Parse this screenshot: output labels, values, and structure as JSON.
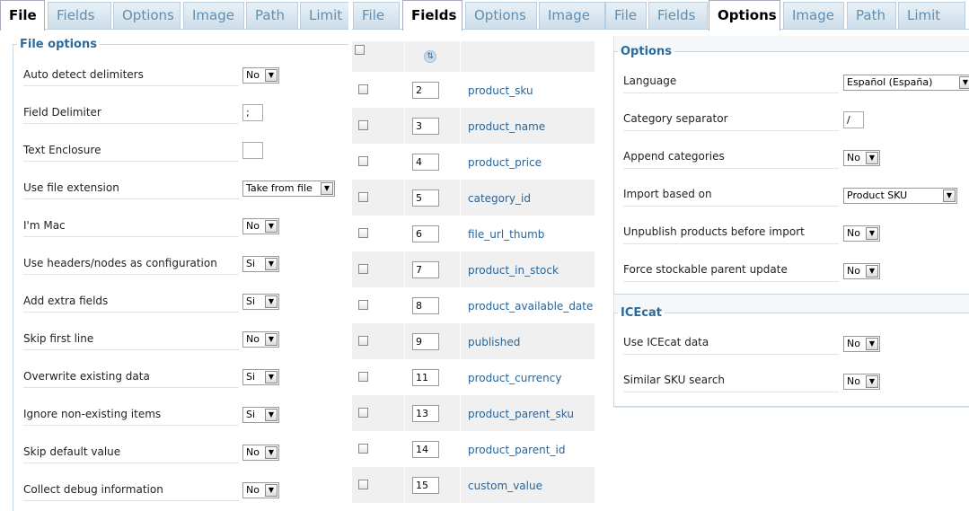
{
  "panel1": {
    "tabs": [
      "File",
      "Fields",
      "Options",
      "Image",
      "Path",
      "Limit"
    ],
    "legend": "File options",
    "rows": [
      {
        "label": "Auto detect delimiters",
        "type": "select",
        "value": "No"
      },
      {
        "label": "Field Delimiter",
        "type": "text",
        "value": ";"
      },
      {
        "label": "Text Enclosure",
        "type": "text",
        "value": ""
      },
      {
        "label": "Use file extension",
        "type": "select",
        "value": "Take from file"
      },
      {
        "label": "I'm Mac",
        "type": "select",
        "value": "No"
      },
      {
        "label": "Use headers/nodes as configuration",
        "type": "select",
        "value": "Si"
      },
      {
        "label": "Add extra fields",
        "type": "select",
        "value": "Si"
      },
      {
        "label": "Skip first line",
        "type": "select",
        "value": "No"
      },
      {
        "label": "Overwrite existing data",
        "type": "select",
        "value": "Si"
      },
      {
        "label": "Ignore non-existing items",
        "type": "select",
        "value": "Si"
      },
      {
        "label": "Skip default value",
        "type": "select",
        "value": "No"
      },
      {
        "label": "Collect debug information",
        "type": "select",
        "value": "No"
      }
    ]
  },
  "panel2": {
    "tabs": [
      "File",
      "Fields",
      "Options",
      "Image"
    ],
    "fields": [
      {
        "order": "2",
        "name": "product_sku"
      },
      {
        "order": "3",
        "name": "product_name"
      },
      {
        "order": "4",
        "name": "product_price"
      },
      {
        "order": "5",
        "name": "category_id"
      },
      {
        "order": "6",
        "name": "file_url_thumb"
      },
      {
        "order": "7",
        "name": "product_in_stock"
      },
      {
        "order": "8",
        "name": "product_available_date"
      },
      {
        "order": "9",
        "name": "published"
      },
      {
        "order": "11",
        "name": "product_currency"
      },
      {
        "order": "13",
        "name": "product_parent_sku"
      },
      {
        "order": "14",
        "name": "product_parent_id"
      },
      {
        "order": "15",
        "name": "custom_value"
      }
    ]
  },
  "panel3": {
    "tabs": [
      "File",
      "Fields",
      "Options",
      "Image",
      "Path",
      "Limit"
    ],
    "options_legend": "Options",
    "options": [
      {
        "label": "Language",
        "type": "select-wide",
        "value": "Español (España)"
      },
      {
        "label": "Category separator",
        "type": "text",
        "value": "/"
      },
      {
        "label": "Append categories",
        "type": "select",
        "value": "No"
      },
      {
        "label": "Import based on",
        "type": "select-mid",
        "value": "Product SKU"
      },
      {
        "label": "Unpublish products before import",
        "type": "select",
        "value": "No"
      },
      {
        "label": "Force stockable parent update",
        "type": "select",
        "value": "No"
      }
    ],
    "icecat_legend": "ICEcat",
    "icecat": [
      {
        "label": "Use ICEcat data",
        "type": "select",
        "value": "No"
      },
      {
        "label": "Similar SKU search",
        "type": "select",
        "value": "No"
      }
    ]
  },
  "icons": {
    "dropdown_arrow": "chevron-down-icon",
    "sort": "sort-icon"
  },
  "colors": {
    "accent": "#2d6a99",
    "link": "#2a6496",
    "tab_bg": "#dbe7f0"
  }
}
